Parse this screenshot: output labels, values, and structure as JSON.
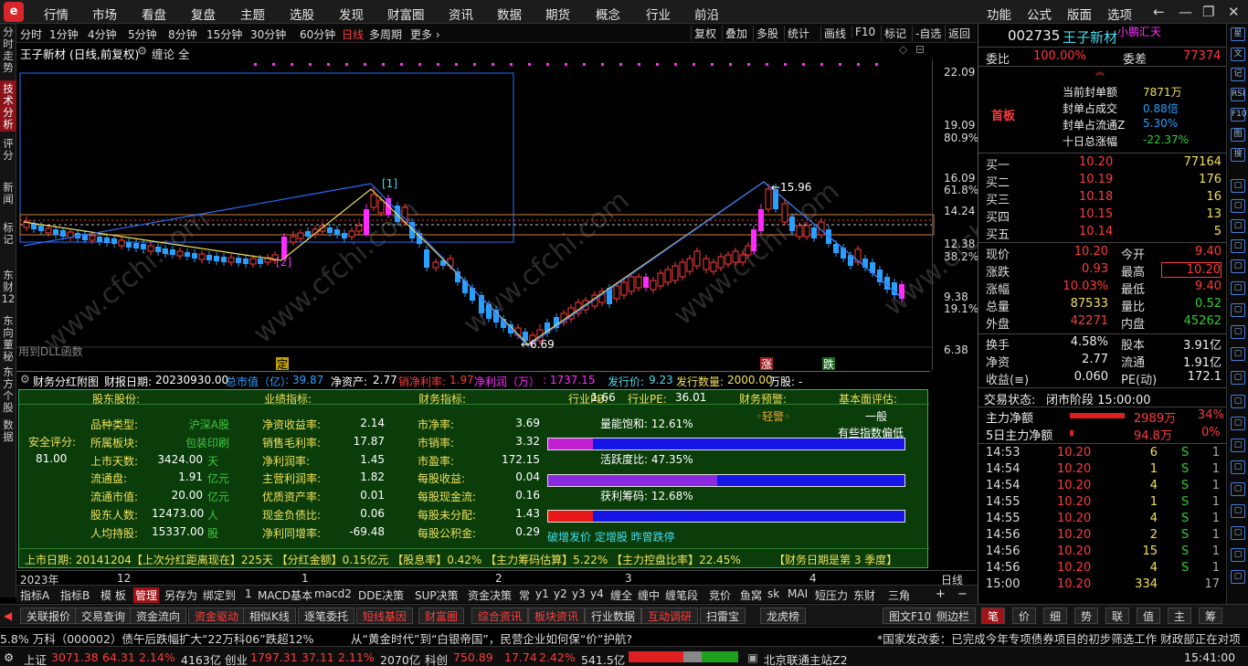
{
  "menubar": {
    "items": [
      "行情",
      "市场",
      "看盘",
      "复盘",
      "主题",
      "选股",
      "发现",
      "财富圈",
      "资讯",
      "数据",
      "期货",
      "概念",
      "行业",
      "前沿"
    ],
    "right_items": [
      "功能",
      "公式",
      "版面",
      "选项"
    ]
  },
  "lefttabs": [
    "分时走势",
    "技术分析",
    "评分",
    "新闻",
    "标记",
    "东财12",
    "东向董秘",
    "东方个股",
    "数据"
  ],
  "toolbar": {
    "periods": [
      "分时",
      "1分钟",
      "4分钟",
      "5分钟",
      "8分钟",
      "15分钟",
      "30分钟",
      "60分钟",
      "日线",
      "多周期",
      "更多 ›"
    ],
    "selected": "日线",
    "right": [
      "复权",
      "叠加",
      "多股",
      "统计",
      "画线",
      "F10",
      "标记",
      "-自选",
      "返回"
    ]
  },
  "chart_header": {
    "title": "王子新材 (日线,前复权)",
    "indicator": "缠论 全"
  },
  "chart": {
    "y_ticks": [
      "22.09",
      "19.09",
      "80.9%",
      "16.09",
      "61.8%",
      "14.24",
      "12.38",
      "38.2%",
      "9.38",
      "19.1%",
      "6.38"
    ],
    "annotations": {
      "high1": "[1]",
      "low1": "[2]",
      "peak": "15.96",
      "trough": "6.69",
      "dll": "用到DLL函数"
    },
    "markers": {
      "ding": "定",
      "zhang": "涨",
      "die": "跌"
    },
    "watermark": "www.cfchi.com",
    "colors": {
      "up": "#ff3b3b",
      "down": "#28a0ff",
      "zt": "#ff2bff",
      "yellow_line": "#f0e05a",
      "blue_line": "#2a6cff"
    }
  },
  "fin_header": {
    "title": "财务分红附图",
    "report_label": "财报日期:",
    "report_date": "20230930.00",
    "mktcap_label": "总市值（亿）",
    "mktcap": ": 39.87",
    "netasset_label": "净资产:",
    "netasset": "2.77",
    "margin_label": "销净利率:",
    "margin": "1.97",
    "profit_label": "净利润（万）",
    "profit": ": 1737.15",
    "issue_price_label": "发行价:",
    "issue_price": "9.23",
    "issue_qty_label": "发行数量:",
    "issue_qty": "2000.00",
    "wangu_label": "万股: -"
  },
  "fin_panel": {
    "headers": [
      "股东股份:",
      "业绩指标:",
      "财务指标:",
      "行业PB:",
      "1.66",
      "行业PE:",
      "36.01",
      "财务预警:",
      "基本面评估:"
    ],
    "safety_label": "安全评分:",
    "safety_score": "81.00",
    "col1": [
      {
        "k": "品种类型:",
        "v": "沪深A股",
        "u": ""
      },
      {
        "k": "所属板块:",
        "v": "包装印刷",
        "u": ""
      },
      {
        "k": "上市天数:",
        "v": "3424.00",
        "u": "天"
      },
      {
        "k": "流通盘:",
        "v": "1.91",
        "u": "亿元"
      },
      {
        "k": "流通市值:",
        "v": "20.00",
        "u": "亿元"
      },
      {
        "k": "股东人数:",
        "v": "12473.00",
        "u": "人"
      },
      {
        "k": "人均持股:",
        "v": "15337.00",
        "u": "股"
      }
    ],
    "col2": [
      {
        "k": "净资收益率:",
        "v": "2.14"
      },
      {
        "k": "销售毛利率:",
        "v": "17.87"
      },
      {
        "k": "净利润率:",
        "v": "1.45"
      },
      {
        "k": "主营利润率:",
        "v": "1.82"
      },
      {
        "k": "优质资产率:",
        "v": "0.01"
      },
      {
        "k": "现金负债比:",
        "v": "0.06"
      },
      {
        "k": "净利同增率:",
        "v": "-69.48"
      }
    ],
    "col3": [
      {
        "k": "市净率:",
        "v": "3.69"
      },
      {
        "k": "市销率:",
        "v": "3.32"
      },
      {
        "k": "市盈率:",
        "v": "172.15"
      },
      {
        "k": "每股收益:",
        "v": "0.04"
      },
      {
        "k": "每股现金流:",
        "v": "0.16"
      },
      {
        "k": "每股未分配:",
        "v": "1.43"
      },
      {
        "k": "每股公积金:",
        "v": "0.29"
      }
    ],
    "warning": "◦轻警◦",
    "assessment1": "一般",
    "assessment2": "有些指数偏低",
    "bars": [
      {
        "label": "量能饱和: 12.61%",
        "value": 0.1261,
        "color": "#c020d0"
      },
      {
        "label": "活跃度比: 47.35%",
        "value": 0.4735,
        "color": "#8a2be2"
      },
      {
        "label": "获利筹码: 12.68%",
        "value": 0.1268,
        "color": "#e81818"
      }
    ],
    "bottom_note": "破增发价 定增股 昨曾跌停",
    "footer": "上市日期: 20141204【上次分红距离现在】225天 【分红金额】0.15亿元 【股息率】0.42% 【主力筹码估算】5.22% 【主力控盘比率】22.45%",
    "footer_right": "【财务日期是第  3  季度】"
  },
  "date_axis": {
    "labels": [
      "2023年",
      "12",
      "1",
      "2",
      "3",
      "4"
    ],
    "period": "日线"
  },
  "ind_tabs": [
    "指标A",
    "指标B",
    "模 板",
    "管理",
    "另存为",
    "绑定到",
    "1",
    "MACD基本",
    "macd2",
    "DDE决策",
    "SUP决策",
    "资金决策",
    "常",
    "y1",
    "y2",
    "y3",
    "y4",
    "缠全",
    "缠中",
    "缠笔段",
    "竞价",
    "鱼窝",
    "sk",
    "MAI",
    "短压力",
    "东财",
    "三角"
  ],
  "ind_selected": "管理",
  "bottom_bar": [
    "关联报价",
    "交易查询",
    "资金流向",
    "资金驱动",
    "相似K线",
    "逐笔委托",
    "短线基因",
    "财富圈",
    "综合资讯",
    "板块资讯",
    "行业数据",
    "互动调研",
    "扫雷宝",
    "龙虎榜",
    "图文F10",
    "侧边栏"
  ],
  "right_tabs": [
    "笔",
    "价",
    "细",
    "势",
    "联",
    "值",
    "主",
    "筹"
  ],
  "ticker": {
    "left": "5.8%   万科（000002）债午后跌幅扩大“22万科06”跌超12%",
    "mid": "从“黄金时代”到“白银帝国”，民营企业如何保“价”护航?",
    "right": "*国家发改委：已完成今年专项债券项目的初步筛选工作 财政部正在对项"
  },
  "status": {
    "sh_label": "上证",
    "sh_val": "3071.38",
    "sh_chg": "64.31",
    "sh_pct": "2.14%",
    "sh_amt": "4163亿",
    "cy_label": "创业",
    "cy_val": "1797.31",
    "cy_chg": "37.11",
    "cy_pct": "2.11%",
    "cy_amt": "2070亿",
    "kc_label": "科创",
    "kc_val": "750.89",
    "kc_chg": "17.74",
    "kc_pct": "2.42%",
    "kc_amt": "541.5亿",
    "server": "北京联通主站Z2",
    "time": "15:41:00"
  },
  "quote": {
    "code": "002735",
    "name": "王子新材",
    "tag": "小鹏汇天",
    "webi_label": "委比",
    "webi": "100.00%",
    "wecha_label": "委差",
    "wecha": "77374",
    "status_label": "首板",
    "info": [
      {
        "k": "当前封单额",
        "v": "7871万",
        "c": "y"
      },
      {
        "k": "封单占成交",
        "v": "0.88倍",
        "c": "b"
      },
      {
        "k": "封单占流通Z",
        "v": "5.30%",
        "c": "b"
      },
      {
        "k": "十日总涨幅",
        "v": "-22.37%",
        "c": "g"
      }
    ],
    "bids": [
      {
        "k": "买一",
        "p": "10.20",
        "v": "77164"
      },
      {
        "k": "买二",
        "p": "10.19",
        "v": "176"
      },
      {
        "k": "买三",
        "p": "10.18",
        "v": "16"
      },
      {
        "k": "买四",
        "p": "10.15",
        "v": "13"
      },
      {
        "k": "买五",
        "p": "10.14",
        "v": "5"
      }
    ],
    "stats": [
      {
        "k1": "现价",
        "v1": "10.20",
        "c1": "r",
        "k2": "今开",
        "v2": "9.40",
        "c2": "r"
      },
      {
        "k1": "涨跌",
        "v1": "0.93",
        "c1": "r",
        "k2": "最高",
        "v2": "10.20",
        "c2": "r"
      },
      {
        "k1": "涨幅",
        "v1": "10.03%",
        "c1": "r",
        "k2": "最低",
        "v2": "9.40",
        "c2": "r"
      },
      {
        "k1": "总量",
        "v1": "87533",
        "c1": "y",
        "k2": "量比",
        "v2": "0.52",
        "c2": "g"
      },
      {
        "k1": "外盘",
        "v1": "42271",
        "c1": "r",
        "k2": "内盘",
        "v2": "45262",
        "c2": "g"
      }
    ],
    "stats2": [
      {
        "k1": "换手",
        "v1": "4.58%",
        "c1": "w",
        "k2": "股本",
        "v2": "3.91亿",
        "c2": "w"
      },
      {
        "k1": "净资",
        "v1": "2.77",
        "c1": "w",
        "k2": "流通",
        "v2": "1.91亿",
        "c2": "w"
      },
      {
        "k1": "收益(≡)",
        "v1": "0.060",
        "c1": "w",
        "k2": "PE(动)",
        "v2": "172.1",
        "c2": "w"
      }
    ],
    "trade_state_label": "交易状态:",
    "trade_state": "闭市阶段 15:00:00",
    "main_net_label": "主力净额",
    "main_net": "2989万",
    "main_net_pct": "34%",
    "main_net5_label": "5日主力净额",
    "main_net5": "94.8万",
    "main_net5_pct": "0%",
    "trades": [
      {
        "t": "14:53",
        "p": "10.20",
        "v": "6",
        "s": "S",
        "n": "1"
      },
      {
        "t": "14:54",
        "p": "10.20",
        "v": "1",
        "s": "S",
        "n": "1"
      },
      {
        "t": "14:54",
        "p": "10.20",
        "v": "4",
        "s": "S",
        "n": "1"
      },
      {
        "t": "14:55",
        "p": "10.20",
        "v": "1",
        "s": "S",
        "n": "1"
      },
      {
        "t": "14:55",
        "p": "10.20",
        "v": "4",
        "s": "S",
        "n": "1"
      },
      {
        "t": "14:56",
        "p": "10.20",
        "v": "2",
        "s": "S",
        "n": "1"
      },
      {
        "t": "14:56",
        "p": "10.20",
        "v": "15",
        "s": "S",
        "n": "1"
      },
      {
        "t": "14:56",
        "p": "10.20",
        "v": "4",
        "s": "S",
        "n": "1"
      },
      {
        "t": "15:00",
        "p": "10.20",
        "v": "334",
        "s": "",
        "n": "17"
      }
    ]
  },
  "sidebar_icons": [
    "星",
    "文",
    "记",
    "RSI",
    "F10",
    "图",
    "搜"
  ]
}
